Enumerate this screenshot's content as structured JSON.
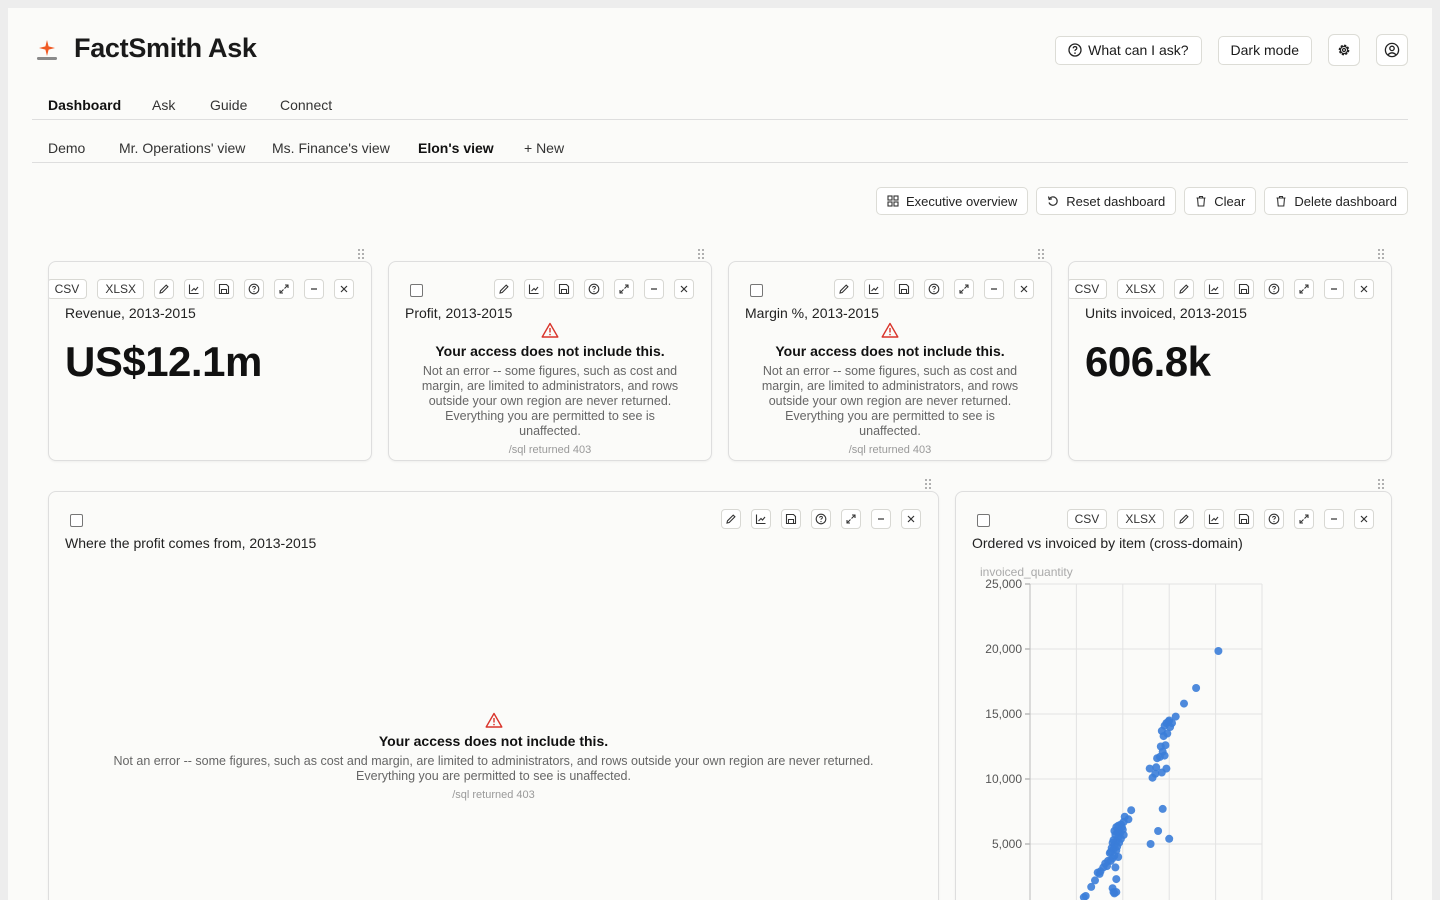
{
  "app": {
    "title": "FactSmith Ask",
    "accent": "#f05a24",
    "brand_icon": "spark-icon"
  },
  "header": {
    "help_label": "What can I ask?",
    "dark_mode_label": "Dark mode",
    "settings_icon": "gear-icon",
    "account_icon": "user-circle-icon"
  },
  "main_tabs": [
    "Dashboard",
    "Ask",
    "Guide",
    "Connect"
  ],
  "main_tab_active": "Dashboard",
  "view_tabs": [
    "Demo",
    "Mr. Operations' view",
    "Ms. Finance's view",
    "Elon's view",
    "+ New"
  ],
  "view_tab_active": "Elon's view",
  "toolbar": {
    "executive_label": "Executive overview",
    "reset_label": "Reset dashboard",
    "clear_label": "Clear",
    "delete_label": "Delete dashboard"
  },
  "chips": {
    "csv": "CSV",
    "xlsx": "XLSX"
  },
  "denied": {
    "heading": "Your access does not include this.",
    "body": "Not an error -- some figures, such as cost and margin, are limited to administrators, and rows outside your own region are never returned. Everything you are permitted to see is unaffected.",
    "footer": "/sql returned 403"
  },
  "cards": {
    "revenue": {
      "title": "Revenue, 2013-2015",
      "value": "US$12.1m"
    },
    "profit": {
      "title": "Profit, 2013-2015"
    },
    "margin": {
      "title": "Margin %, 2013-2015"
    },
    "units": {
      "title": "Units invoiced, 2013-2015",
      "value": "606.8k"
    },
    "profit_source": {
      "title": "Where the profit comes from, 2013-2015"
    },
    "scatter": {
      "title": "Ordered vs invoiced by item (cross-domain)"
    }
  },
  "chart_data": {
    "type": "scatter",
    "ylabel": "invoiced_quantity",
    "yticks": [
      "25,000",
      "20,000",
      "15,000",
      "10,000",
      "5,000"
    ],
    "ylim": [
      0,
      25000
    ],
    "xlim": [
      0,
      25000
    ],
    "grid": true,
    "color": "#3b7dd8",
    "points": [
      [
        20300,
        19850
      ],
      [
        17900,
        17000
      ],
      [
        16600,
        15800
      ],
      [
        15000,
        14500
      ],
      [
        15700,
        14800
      ],
      [
        15300,
        14300
      ],
      [
        14700,
        14300
      ],
      [
        14900,
        14400
      ],
      [
        14500,
        14100
      ],
      [
        15100,
        14000
      ],
      [
        14200,
        13700
      ],
      [
        14800,
        13500
      ],
      [
        14400,
        13300
      ],
      [
        14600,
        12600
      ],
      [
        14100,
        12500
      ],
      [
        14300,
        12100
      ],
      [
        14500,
        11800
      ],
      [
        14000,
        11700
      ],
      [
        13700,
        11600
      ],
      [
        13600,
        10900
      ],
      [
        12900,
        10800
      ],
      [
        14700,
        10800
      ],
      [
        14200,
        10500
      ],
      [
        13500,
        10400
      ],
      [
        13200,
        10100
      ],
      [
        14300,
        7700
      ],
      [
        13800,
        6000
      ],
      [
        15000,
        5400
      ],
      [
        13000,
        5000
      ],
      [
        10900,
        7600
      ],
      [
        10200,
        7100
      ],
      [
        10600,
        6900
      ],
      [
        10100,
        6700
      ],
      [
        9800,
        6500
      ],
      [
        9500,
        6400
      ],
      [
        9900,
        6300
      ],
      [
        9300,
        6300
      ],
      [
        10000,
        6100
      ],
      [
        9600,
        6000
      ],
      [
        9100,
        6000
      ],
      [
        9400,
        5900
      ],
      [
        9700,
        5800
      ],
      [
        10100,
        5700
      ],
      [
        9200,
        5700
      ],
      [
        9500,
        5500
      ],
      [
        9800,
        5400
      ],
      [
        9000,
        5300
      ],
      [
        9300,
        5200
      ],
      [
        9600,
        5100
      ],
      [
        8900,
        5100
      ],
      [
        9100,
        4900
      ],
      [
        9400,
        4800
      ],
      [
        8800,
        4700
      ],
      [
        9000,
        4600
      ],
      [
        9300,
        4500
      ],
      [
        8700,
        4400
      ],
      [
        8600,
        4300
      ],
      [
        9100,
        4100
      ],
      [
        9500,
        4000
      ],
      [
        8900,
        3900
      ],
      [
        8400,
        3700
      ],
      [
        8700,
        3700
      ],
      [
        8100,
        3500
      ],
      [
        8300,
        3300
      ],
      [
        7900,
        3200
      ],
      [
        9200,
        3200
      ],
      [
        7600,
        2900
      ],
      [
        7300,
        2800
      ],
      [
        7500,
        2700
      ],
      [
        9300,
        2300
      ],
      [
        7000,
        2200
      ],
      [
        6600,
        1700
      ],
      [
        8900,
        1600
      ],
      [
        9000,
        1300
      ],
      [
        9300,
        1300
      ],
      [
        9100,
        1200
      ],
      [
        6000,
        1000
      ],
      [
        5800,
        900
      ]
    ]
  }
}
